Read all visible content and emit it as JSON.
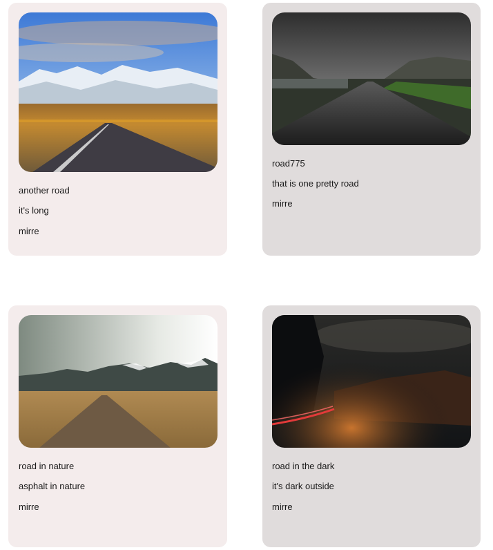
{
  "cards": [
    {
      "title": "another road",
      "description": "it's long",
      "author": "mirre",
      "photo": "snowy-mountain-road-photo"
    },
    {
      "title": "road775",
      "description": "that is one pretty road",
      "author": "mirre",
      "photo": "gray-valley-road-photo"
    },
    {
      "title": "road in nature",
      "description": "asphalt in nature",
      "author": "mirre",
      "photo": "gravel-road-field-photo"
    },
    {
      "title": "road in the dark",
      "description": "it's dark outside",
      "author": "mirre",
      "photo": "night-canyon-road-photo"
    }
  ],
  "colors": {
    "card_pink": "#f4ecec",
    "card_gray": "#e0dcdc",
    "text": "#1a1a1a"
  }
}
